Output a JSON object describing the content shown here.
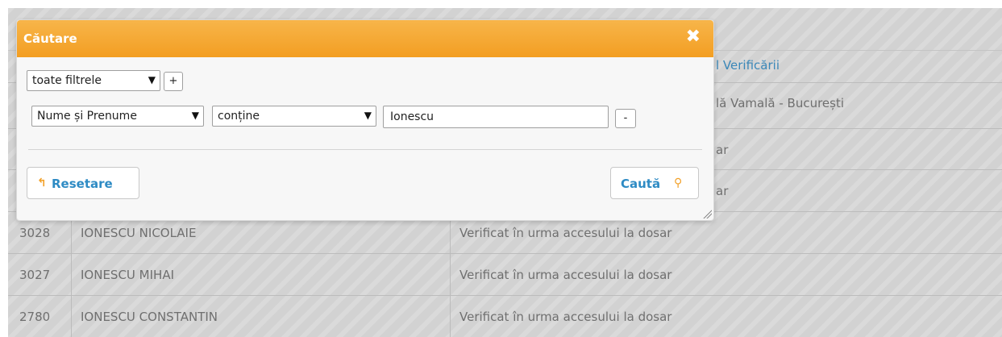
{
  "grid": {
    "header_col_fragment": "l Verificării",
    "row0_status_fragment": "lă Vamală - București",
    "row1_status_fragment": "ar",
    "row2_status_fragment": "ar",
    "rows": [
      {
        "id": "3028",
        "name": "IONESCU NICOLAIE",
        "status": "Verificat în urma accesului la dosar"
      },
      {
        "id": "3027",
        "name": "IONESCU MIHAI",
        "status": "Verificat în urma accesului la dosar"
      },
      {
        "id": "2780",
        "name": "IONESCU CONSTANTIN",
        "status": "Verificat în urma accesului la dosar"
      }
    ]
  },
  "dialog": {
    "title": "Căutare",
    "close_glyph": "✖",
    "group_op": "toate filtrele",
    "add_label": "+",
    "remove_label": "-",
    "filter": {
      "field": "Nume și Prenume",
      "op": "conține",
      "value": "Ionescu"
    },
    "reset_label": "Resetare",
    "search_label": "Caută"
  },
  "colors": {
    "accent": "#f39e22",
    "link": "#2e8bc4"
  },
  "icons": {
    "reset": "undo-icon",
    "search": "magnifier-icon",
    "close": "close-icon"
  }
}
